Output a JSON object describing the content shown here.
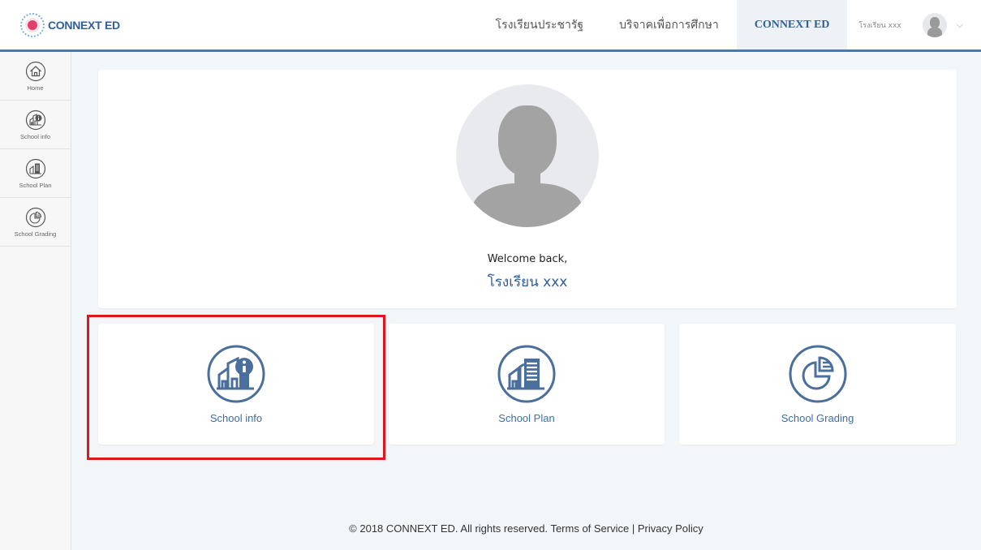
{
  "brand": {
    "logo_text": "CONNEXT ED"
  },
  "nav": {
    "items": [
      {
        "label": "โรงเรียนประชารัฐ"
      },
      {
        "label": "บริจาคเพื่อการศึกษา"
      },
      {
        "label": "CONNEXT ED"
      }
    ],
    "user_name": "โรงเรียน xxx",
    "chevron": "⌵"
  },
  "sidebar": {
    "items": [
      {
        "label": "Home",
        "icon": "home-icon"
      },
      {
        "label": "School info",
        "icon": "school-info-icon"
      },
      {
        "label": "School Plan",
        "icon": "school-plan-icon"
      },
      {
        "label": "School Grading",
        "icon": "school-grading-icon"
      }
    ]
  },
  "welcome": {
    "greeting": "Welcome back,",
    "school_name": "โรงเรียน xxx"
  },
  "tiles": [
    {
      "label": "School info",
      "icon": "school-info-icon"
    },
    {
      "label": "School Plan",
      "icon": "school-plan-icon"
    },
    {
      "label": "School Grading",
      "icon": "school-grading-icon"
    }
  ],
  "footer": {
    "copyright": "© 2018 CONNEXT ED. All rights reserved.",
    "terms": "Terms of Service",
    "separator": "|",
    "privacy": "Privacy Policy"
  },
  "colors": {
    "accent": "#2f5f9a",
    "icon": "#4a6f9c",
    "highlight": "#e3141c"
  }
}
